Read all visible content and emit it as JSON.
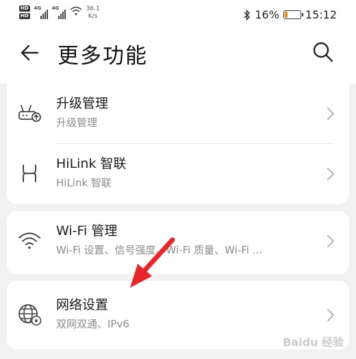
{
  "status_bar": {
    "hd1": "HD",
    "hd2": "HD",
    "sig1": "4G",
    "sig2": "4G",
    "net_speed_value": "36.1",
    "net_speed_unit": "K/s",
    "battery_percent": "16%",
    "time": "15:12",
    "battery_color": "#f08c1a"
  },
  "header": {
    "title": "更多功能",
    "back_icon": "arrow-left-icon",
    "search_icon": "search-icon"
  },
  "items": [
    {
      "title": "升级管理",
      "subtitle": "升级管理",
      "icon": "router-upgrade-icon"
    },
    {
      "title": "HiLink 智联",
      "subtitle": "HiLink 智联",
      "icon": "hilink-icon"
    },
    {
      "title": "Wi-Fi 管理",
      "subtitle": "Wi-Fi 设置、信号强度、Wi-Fi 质量、Wi-Fi ...",
      "icon": "wifi-icon"
    },
    {
      "title": "网络设置",
      "subtitle": "双网双通、IPv6",
      "icon": "globe-settings-icon"
    }
  ],
  "annotation": {
    "arrow_color": "#e8262a"
  },
  "watermark": {
    "text": "Baidu 经验"
  }
}
